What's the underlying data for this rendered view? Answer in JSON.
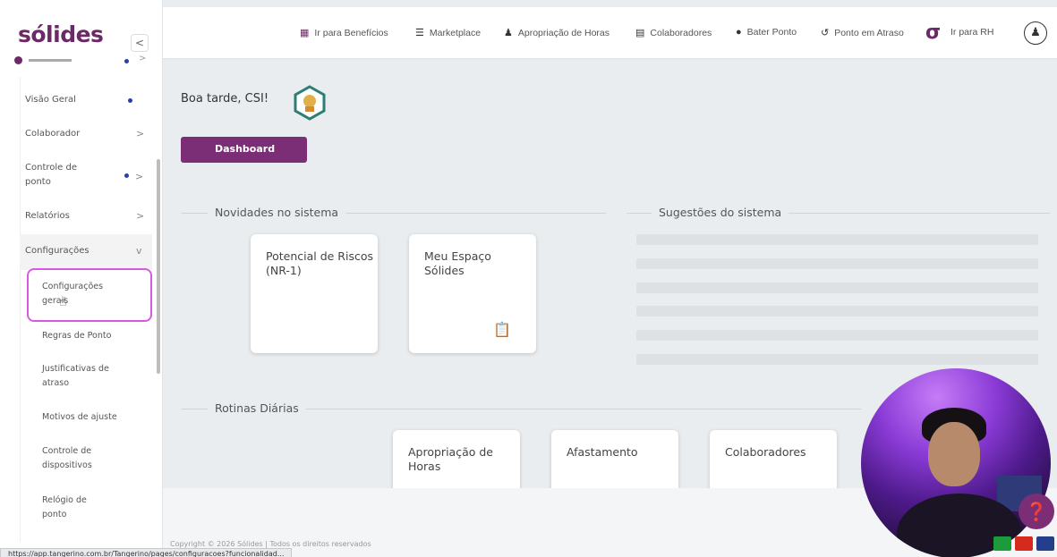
{
  "brand": {
    "logo": "sólides",
    "accent": "#7b2e76"
  },
  "sidebar": {
    "items": [
      {
        "label": "Visão Geral",
        "dot": true,
        "chevron": ""
      },
      {
        "label": "Colaborador",
        "dot": false,
        "chevron": ">"
      },
      {
        "label": "Controle de ponto",
        "dot": true,
        "chevron": ">"
      },
      {
        "label": "Relatórios",
        "dot": false,
        "chevron": ">"
      },
      {
        "label": "Configurações",
        "dot": false,
        "chevron": "v"
      }
    ],
    "sub_items": [
      "Configurações gerais",
      "Regras de Ponto",
      "Justificativas de atraso",
      "Motivos de ajuste",
      "Controle de dispositivos",
      "Relógio de ponto"
    ]
  },
  "topbar": {
    "items": [
      {
        "label": "Ir para Benefícios",
        "icon": "briefcase-icon"
      },
      {
        "label": "Marketplace",
        "icon": "cart-icon"
      },
      {
        "label": "Apropriação de Horas",
        "icon": "people-icon"
      },
      {
        "label": "Colaboradores",
        "icon": "notebook-icon"
      },
      {
        "label": "Bater Ponto",
        "icon": "clock-icon"
      },
      {
        "label": "Ponto em Atraso",
        "icon": "history-icon"
      },
      {
        "label": "Ir para RH",
        "icon": "solides-icon"
      }
    ]
  },
  "main": {
    "greeting": "Boa tarde, CSI!",
    "dashboard_button": "Dashboard",
    "novidades_title": "Novidades no sistema",
    "sugestoes_title": "Sugestões do sistema",
    "rotinas_title": "Rotinas Diárias",
    "novidades_cards": [
      "Potencial de Riscos (NR-1)",
      "Meu Espaço Sólides"
    ],
    "rotinas_cards": [
      "Apropriação de Horas",
      "Afastamento",
      "Colaboradores"
    ]
  },
  "footer": {
    "copyright": "Copyright © 2026 Sólides | Todos os direitos reservados",
    "status_url": "https://app.tangerino.com.br/Tangerino/pages/configuracoes?funcionalidad..."
  }
}
